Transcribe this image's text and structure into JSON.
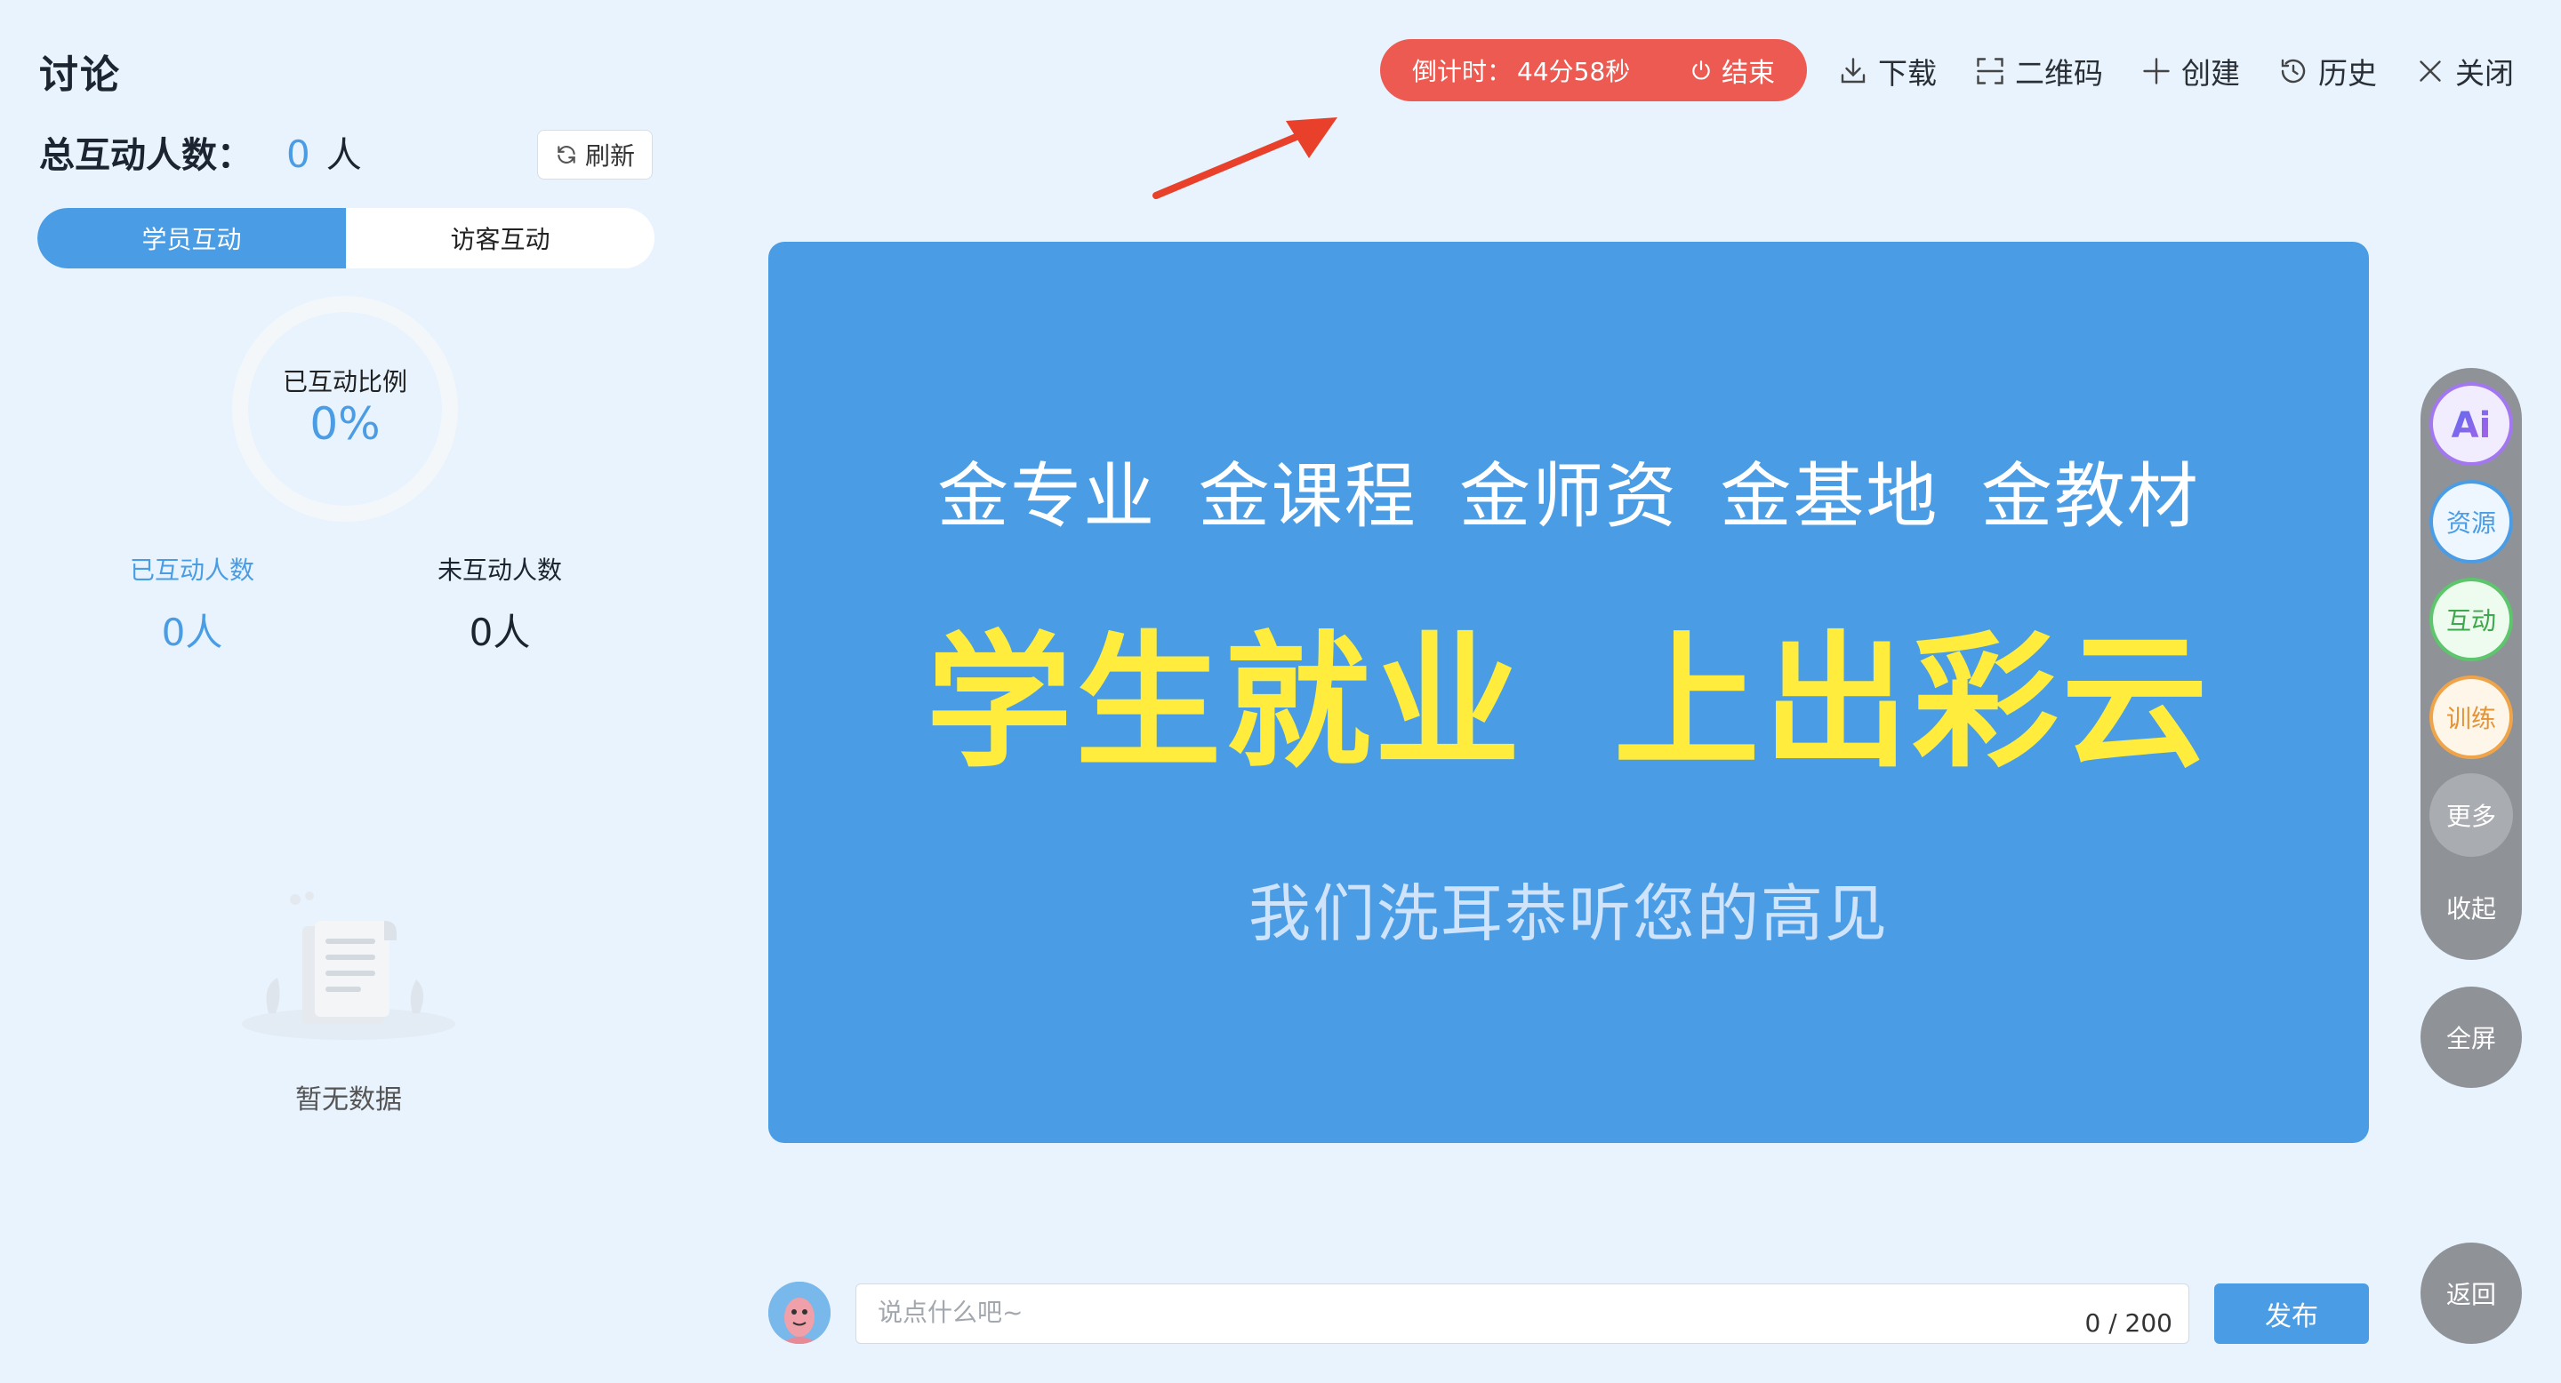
{
  "panel": {
    "title": "讨论",
    "total_label": "总互动人数：",
    "total_value": "0",
    "total_unit": "人",
    "refresh_label": "刷新",
    "tabs": [
      {
        "label": "学员互动",
        "active": true
      },
      {
        "label": "访客互动",
        "active": false
      }
    ],
    "ratio_label": "已互动比例",
    "ratio_value": "0%",
    "interacted_label": "已互动人数",
    "interacted_value": "0人",
    "not_interacted_label": "未互动人数",
    "not_interacted_value": "0人",
    "empty_text": "暂无数据"
  },
  "topbar": {
    "countdown_label": "倒计时：",
    "countdown_value": "44分58秒",
    "end_label": "结束",
    "actions": [
      {
        "label": "下载",
        "icon": "download-icon"
      },
      {
        "label": "二维码",
        "icon": "qrcode-scan-icon"
      },
      {
        "label": "创建",
        "icon": "plus-icon"
      },
      {
        "label": "历史",
        "icon": "history-icon"
      },
      {
        "label": "关闭",
        "icon": "close-icon"
      }
    ]
  },
  "slide": {
    "line1": "金专业 金课程 金师资 金基地 金教材",
    "line2": "学生就业 上出彩云",
    "line3": "我们洗耳恭听您的高见"
  },
  "tools": {
    "ai": "Ai",
    "resources": "资源",
    "interaction": "互动",
    "training": "训练",
    "more": "更多",
    "collapse": "收起",
    "fullscreen": "全屏",
    "back": "返回"
  },
  "comment": {
    "placeholder": "说点什么吧~",
    "value": "",
    "count": "0 / 200",
    "publish_label": "发布"
  },
  "colors": {
    "accent": "#4a9de4",
    "danger": "#ec5a52",
    "headline": "#ffec3d",
    "background": "#e8f3fd"
  }
}
